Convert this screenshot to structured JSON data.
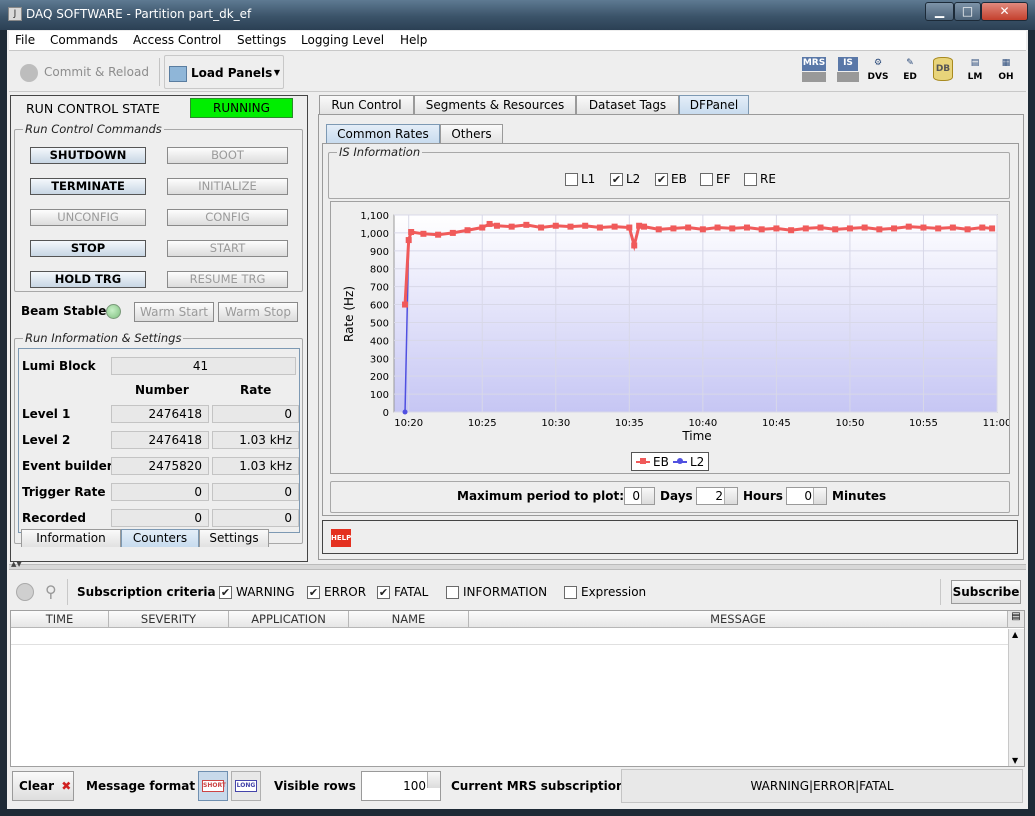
{
  "window": {
    "title": "DAQ SOFTWARE - Partition part_dk_ef",
    "app_icon": "java-icon"
  },
  "menu": [
    "File",
    "Commands",
    "Access Control",
    "Settings",
    "Logging Level",
    "Help"
  ],
  "toolbar": {
    "commit_label": "Commit & Reload",
    "load_panels_label": "Load Panels",
    "tools": [
      "MRS",
      "IS",
      "DVS",
      "ED",
      "DB",
      "LM",
      "OH"
    ]
  },
  "run_control": {
    "state_label": "RUN CONTROL STATE",
    "state_value": "RUNNING",
    "state_color": "#00ee00",
    "commands_title": "Run Control Commands",
    "buttons_left": [
      "SHUTDOWN",
      "TERMINATE",
      "UNCONFIG",
      "STOP",
      "HOLD TRG"
    ],
    "buttons_right": [
      "BOOT",
      "INITIALIZE",
      "CONFIG",
      "START",
      "RESUME TRG"
    ],
    "beam_label": "Beam Stable",
    "warm_start": "Warm Start",
    "warm_stop": "Warm Stop"
  },
  "run_info": {
    "title": "Run Information & Settings",
    "lumi_label": "Lumi Block",
    "lumi_value": "41",
    "col_number": "Number",
    "col_rate": "Rate",
    "rows": [
      {
        "label": "Level 1",
        "number": "2476418",
        "rate": "0"
      },
      {
        "label": "Level 2",
        "number": "2476418",
        "rate": "1.03 kHz"
      },
      {
        "label": "Event builder",
        "number": "2475820",
        "rate": "1.03 kHz"
      },
      {
        "label": "Trigger Rate",
        "number": "0",
        "rate": "0"
      },
      {
        "label": "Recorded",
        "number": "0",
        "rate": "0"
      }
    ],
    "tabs": [
      "Information",
      "Counters",
      "Settings"
    ]
  },
  "main_tabs": [
    "Run Control",
    "Segments & Resources",
    "Dataset Tags",
    "DFPanel"
  ],
  "sub_tabs": [
    "Common Rates",
    "Others"
  ],
  "is_info": {
    "title": "IS Information",
    "checkboxes": [
      {
        "label": "L1",
        "checked": false
      },
      {
        "label": "L2",
        "checked": true
      },
      {
        "label": "EB",
        "checked": true
      },
      {
        "label": "EF",
        "checked": false
      },
      {
        "label": "RE",
        "checked": false
      }
    ]
  },
  "chart_data": {
    "type": "line",
    "xlabel": "Time",
    "ylabel": "Rate (Hz)",
    "ylim": [
      0,
      1100
    ],
    "yticks": [
      "0",
      "100",
      "200",
      "300",
      "400",
      "500",
      "600",
      "700",
      "800",
      "900",
      "1,000",
      "1,100"
    ],
    "xticks": [
      "10:20",
      "10:25",
      "10:30",
      "10:35",
      "10:40",
      "10:45",
      "10:50",
      "10:55",
      "11:00"
    ],
    "x_minutes_range": [
      10.75,
      11.0
    ],
    "grid": true,
    "legend_position": "bottom",
    "series": [
      {
        "name": "EB",
        "color": "#f05a5a",
        "points": [
          [
            "10:19:45",
            600
          ],
          [
            "10:20:00",
            960
          ],
          [
            "10:20:10",
            1005
          ],
          [
            "10:21:00",
            995
          ],
          [
            "10:22:00",
            990
          ],
          [
            "10:23:00",
            1000
          ],
          [
            "10:24:00",
            1015
          ],
          [
            "10:25:00",
            1030
          ],
          [
            "10:25:30",
            1050
          ],
          [
            "10:26:00",
            1040
          ],
          [
            "10:27:00",
            1035
          ],
          [
            "10:28:00",
            1045
          ],
          [
            "10:29:00",
            1030
          ],
          [
            "10:30:00",
            1040
          ],
          [
            "10:31:00",
            1035
          ],
          [
            "10:32:00",
            1040
          ],
          [
            "10:33:00",
            1030
          ],
          [
            "10:34:00",
            1035
          ],
          [
            "10:35:00",
            1030
          ],
          [
            "10:35:20",
            930
          ],
          [
            "10:35:40",
            1040
          ],
          [
            "10:36:00",
            1035
          ],
          [
            "10:37:00",
            1020
          ],
          [
            "10:38:00",
            1025
          ],
          [
            "10:39:00",
            1030
          ],
          [
            "10:40:00",
            1020
          ],
          [
            "10:41:00",
            1030
          ],
          [
            "10:42:00",
            1025
          ],
          [
            "10:43:00",
            1030
          ],
          [
            "10:44:00",
            1020
          ],
          [
            "10:45:00",
            1025
          ],
          [
            "10:46:00",
            1015
          ],
          [
            "10:47:00",
            1025
          ],
          [
            "10:48:00",
            1030
          ],
          [
            "10:49:00",
            1020
          ],
          [
            "10:50:00",
            1025
          ],
          [
            "10:51:00",
            1030
          ],
          [
            "10:52:00",
            1020
          ],
          [
            "10:53:00",
            1025
          ],
          [
            "10:54:00",
            1035
          ],
          [
            "10:55:00",
            1030
          ],
          [
            "10:56:00",
            1025
          ],
          [
            "10:57:00",
            1030
          ],
          [
            "10:58:00",
            1020
          ],
          [
            "10:59:00",
            1030
          ],
          [
            "10:59:40",
            1025
          ]
        ]
      },
      {
        "name": "L2",
        "color": "#5050e0",
        "points": [
          [
            "10:19:45",
            0
          ],
          [
            "10:20:00",
            960
          ],
          [
            "10:20:10",
            1005
          ]
        ]
      }
    ]
  },
  "plot_period": {
    "label": "Maximum period to plot:",
    "days": "0",
    "days_label": "Days",
    "hours": "2",
    "hours_label": "Hours",
    "minutes": "0",
    "minutes_label": "Minutes"
  },
  "help_label": "HELP",
  "subscription": {
    "label": "Subscription criteria",
    "checkboxes": [
      {
        "label": "WARNING",
        "checked": true
      },
      {
        "label": "ERROR",
        "checked": true
      },
      {
        "label": "FATAL",
        "checked": true
      },
      {
        "label": "INFORMATION",
        "checked": false
      },
      {
        "label": "Expression",
        "checked": false
      }
    ],
    "subscribe_label": "Subscribe"
  },
  "message_table": {
    "columns": [
      "TIME",
      "SEVERITY",
      "APPLICATION",
      "NAME",
      "MESSAGE"
    ]
  },
  "status": {
    "clear_label": "Clear",
    "format_label": "Message format",
    "short_label": "SHORT",
    "long_label": "LONG",
    "visible_rows_label": "Visible rows",
    "visible_rows_value": "100",
    "mrs_label": "Current MRS subscription",
    "mrs_value": "WARNING|ERROR|FATAL"
  }
}
